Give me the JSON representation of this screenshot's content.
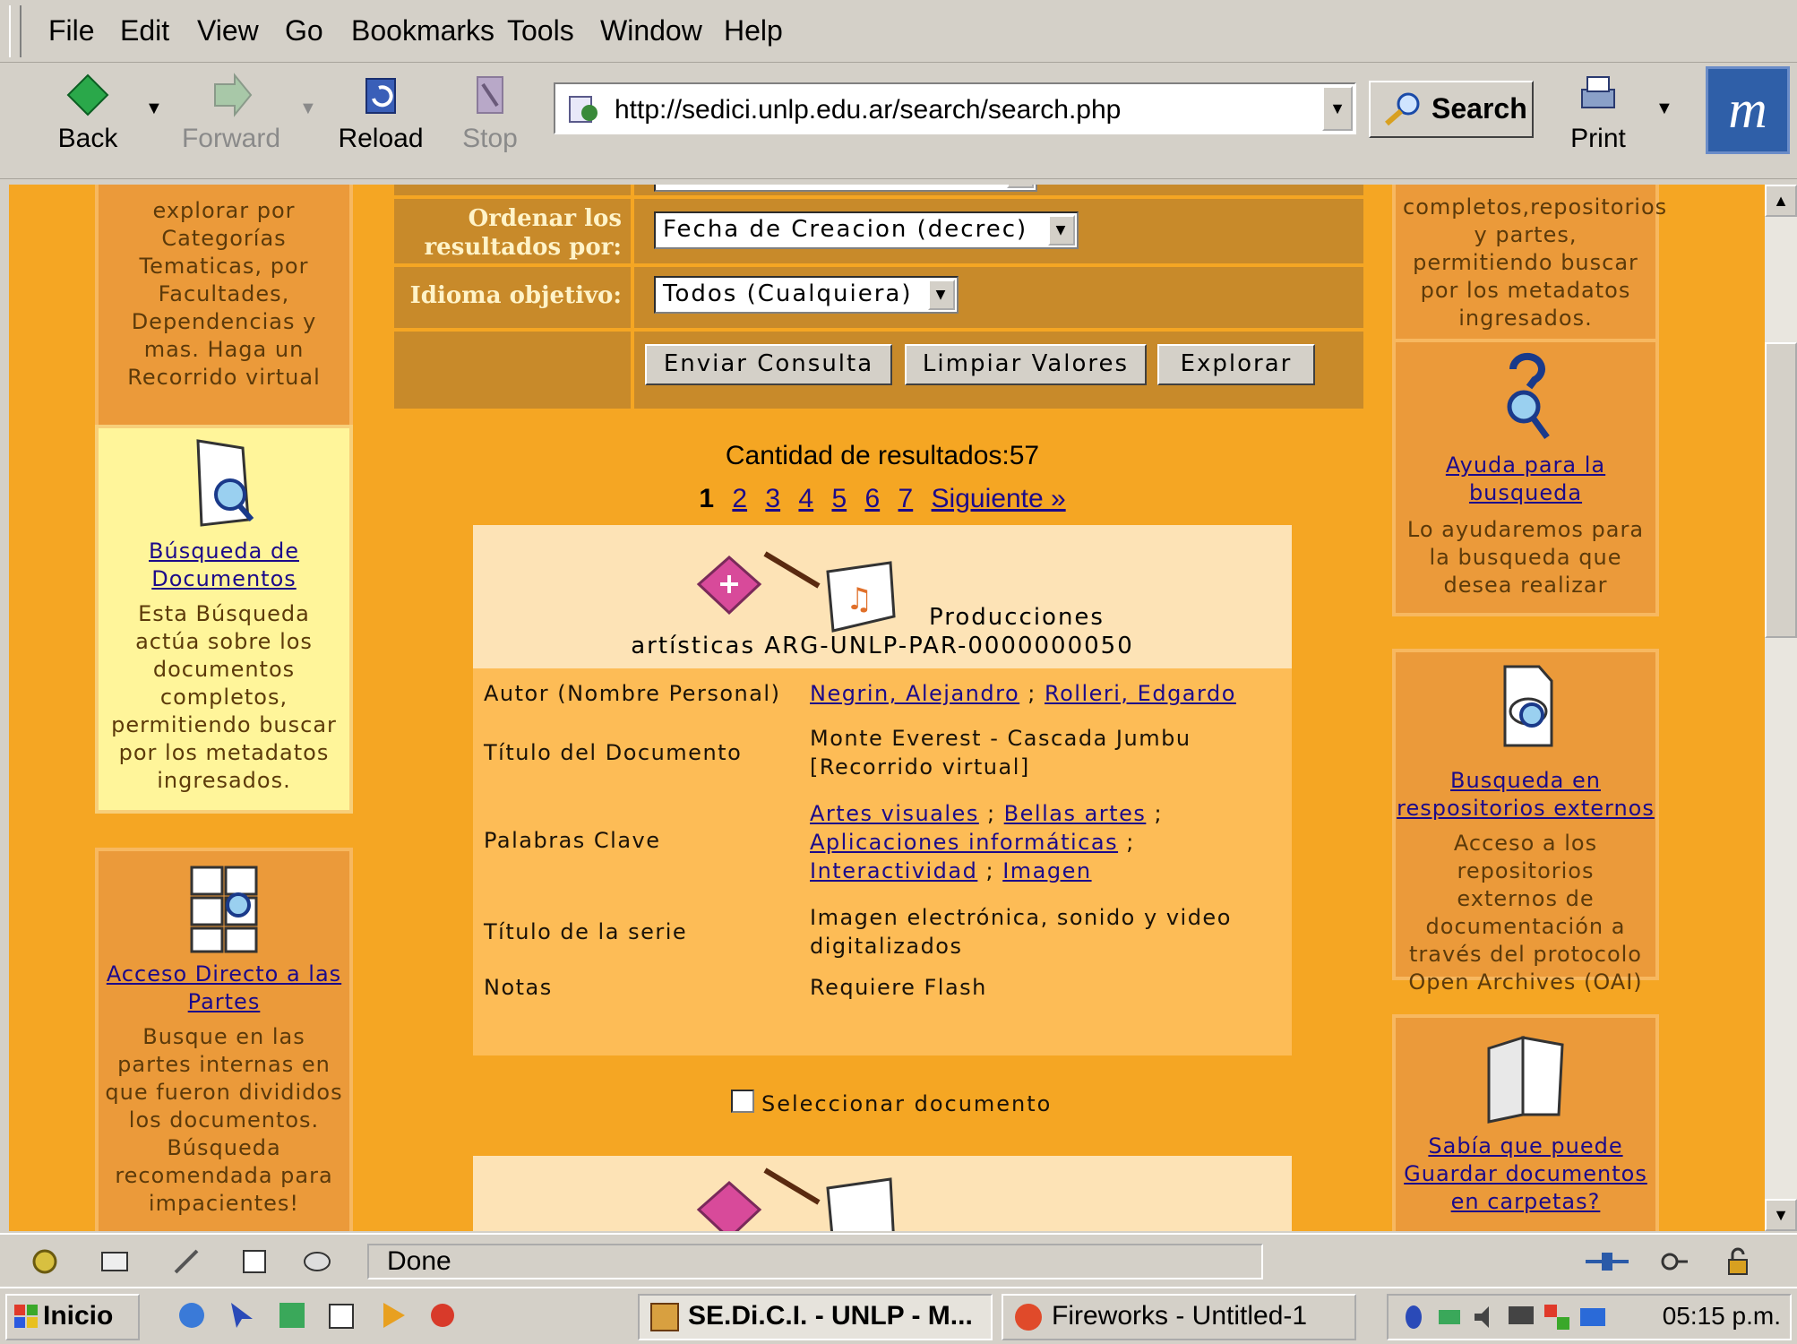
{
  "menubar": {
    "items": [
      "File",
      "Edit",
      "View",
      "Go",
      "Bookmarks",
      "Tools",
      "Window",
      "Help"
    ]
  },
  "toolbar": {
    "back": "Back",
    "forward": "Forward",
    "reload": "Reload",
    "stop": "Stop",
    "search": "Search",
    "print": "Print"
  },
  "address": {
    "url": "http://sedici.unlp.edu.ar/search/search.php"
  },
  "left": {
    "card1": {
      "text": "explorar por Categorías Tematicas, por Facultades, Dependencias y mas. Haga un Recorrido virtual"
    },
    "card2": {
      "link": "Búsqueda de Documentos",
      "text": "Esta Búsqueda actúa sobre los documentos completos, permitiendo buscar por los metadatos ingresados."
    },
    "card3": {
      "link": "Acceso Directo a las Partes",
      "text": "Busque en las partes internas en que fueron divididos los documentos. Búsqueda recomendada para impacientes!"
    }
  },
  "right": {
    "card1": {
      "text": "completos,repositorios y partes, permitiendo buscar por los metadatos ingresados."
    },
    "card2": {
      "link": "Ayuda para la busqueda",
      "text": "Lo ayudaremos para la busqueda que desea realizar"
    },
    "card3": {
      "link": "Busqueda en respositorios externos",
      "text": "Acceso a los repositorios externos de documentación a través del protocolo Open Archives (OAI)"
    },
    "card4": {
      "link": "Sabía que puede Guardar documentos en carpetas?"
    }
  },
  "form": {
    "order_label": "Ordenar los resultados por:",
    "order_value": "Fecha de Creacion (decrec)",
    "lang_label": "Idioma objetivo:",
    "lang_value": "Todos (Cualquiera)",
    "btn_send": "Enviar Consulta",
    "btn_clear": "Limpiar Valores",
    "btn_explore": "Explorar"
  },
  "results": {
    "count": "Cantidad de resultados:57",
    "current_page": "1",
    "pages": [
      "2",
      "3",
      "4",
      "5",
      "6",
      "7"
    ],
    "next": "Siguiente »"
  },
  "document": {
    "type_line1": "Producciones",
    "type_line2": "artísticas ARG-UNLP-PAR-0000000050",
    "author_label": "Autor (Nombre Personal)",
    "author1": "Negrin, Alejandro",
    "author_sep": " ; ",
    "author2": "Rolleri, Edgardo",
    "title_label": "Título del Documento",
    "title_value": "Monte Everest - Cascada Jumbu [Recorrido virtual]",
    "keywords_label": "Palabras Clave",
    "kw1": "Artes visuales",
    "kw2": "Bellas artes",
    "kw3": "Aplicaciones informáticas",
    "kw4": "Interactividad",
    "kw5": "Imagen",
    "sep": " ; ",
    "series_label": "Título de la serie",
    "series_value": "Imagen electrónica, sonido y video digitalizados",
    "notes_label": "Notas",
    "notes_value": "Requiere Flash",
    "select_label": "Seleccionar documento"
  },
  "status": {
    "text": "Done"
  },
  "taskbar": {
    "start": "Inicio",
    "task1": "SE.Di.C.I. - UNLP - M...",
    "task2": "Fireworks - Untitled-1",
    "clock": "05:15 p.m."
  },
  "colors": {
    "page_bg": "#f5a623",
    "card": "#eb9a3a",
    "link": "#1c0a8a",
    "form": "#c88a2a"
  }
}
